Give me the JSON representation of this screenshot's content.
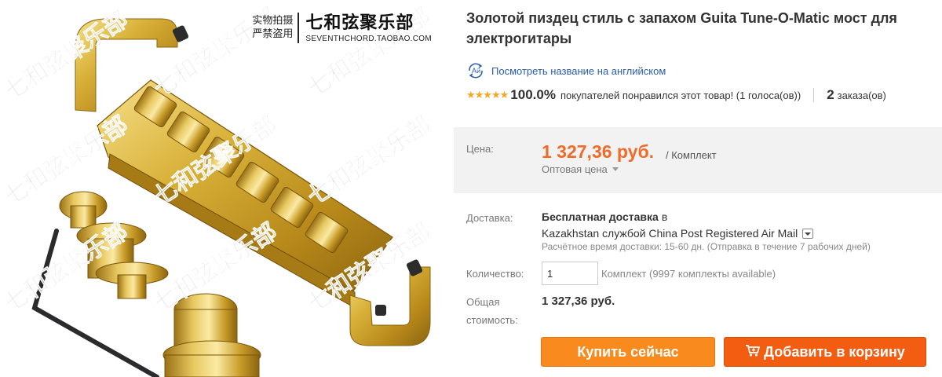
{
  "image": {
    "logo_left_line1": "实物拍摄",
    "logo_left_line2": "严禁盗用",
    "logo_cn": "七和弦聚乐部",
    "logo_url": "SEVENTHCHORD.TAOBAO.COM",
    "watermark": "七和弦聚乐部"
  },
  "product": {
    "title": "Золотой пиздец стиль с запахом Guita Tune-O-Matic мост для электрогитары",
    "translate_link": "Посмотреть название на английском",
    "translate_icon": "translate-icon",
    "rating_stars": "★★★★★",
    "rating_percent": "100.0%",
    "rating_text": "покупателей понравился этот товар! (1 голоса(ов))",
    "orders_count": "2",
    "orders_label": "заказа(ов)"
  },
  "price": {
    "label": "Цена:",
    "value": "1 327,36 руб.",
    "unit": "/ Комплект",
    "wholesale": "Оптовая цена"
  },
  "shipping": {
    "label": "Доставка:",
    "free": "Бесплатная доставка",
    "in": "в",
    "destination": "Kazakhstan службой China Post Registered Air Mail",
    "eta": "Расчётное время доставки: 15-60 дн. (Отправка в течение 7 рабочих дней)"
  },
  "quantity": {
    "label": "Количество:",
    "value": "1",
    "available": "Комплект (9997 комплекты available)"
  },
  "total": {
    "label_line1": "Общая",
    "label_line2": "стоимость:",
    "value": "1 327,36 руб."
  },
  "buttons": {
    "buy": "Купить сейчас",
    "cart": "Добавить в корзину"
  },
  "colors": {
    "price": "#f06a28",
    "buy_button": "#f88a1e",
    "cart_button": "#f25d12",
    "link": "#2a5cb0",
    "stars": "#f5a623"
  }
}
